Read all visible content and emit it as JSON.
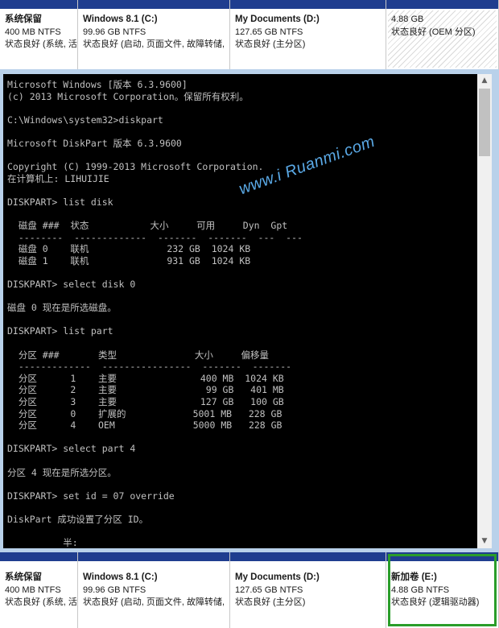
{
  "top_partitions": [
    {
      "name": "系统保留",
      "size": "400 MB NTFS",
      "status": "状态良好 (系统, 活"
    },
    {
      "name": "Windows 8.1  (C:)",
      "size": "99.96 GB NTFS",
      "status": "状态良好 (启动, 页面文件, 故障转储,"
    },
    {
      "name": "My Documents  (D:)",
      "size": "127.65 GB NTFS",
      "status": "状态良好 (主分区)"
    },
    {
      "name": "",
      "size": "4.88 GB",
      "status": "状态良好 (OEM 分区)"
    }
  ],
  "bottom_partitions": [
    {
      "name": "系统保留",
      "size": "400 MB NTFS",
      "status": "状态良好 (系统, 活"
    },
    {
      "name": "Windows 8.1  (C:)",
      "size": "99.96 GB NTFS",
      "status": "状态良好 (启动, 页面文件, 故障转储,"
    },
    {
      "name": "My Documents  (D:)",
      "size": "127.65 GB NTFS",
      "status": "状态良好 (主分区)"
    },
    {
      "name": "新加卷  (E:)",
      "size": "4.88 GB NTFS",
      "status": "状态良好 (逻辑驱动器)"
    }
  ],
  "console": {
    "lines": [
      "Microsoft Windows [版本 6.3.9600]",
      "(c) 2013 Microsoft Corporation。保留所有权利。",
      "",
      "C:\\Windows\\system32>diskpart",
      "",
      "Microsoft DiskPart 版本 6.3.9600",
      "",
      "Copyright (C) 1999-2013 Microsoft Corporation.",
      "在计算机上: LIHUIJIE",
      "",
      "DISKPART> list disk",
      "",
      "  磁盘 ###  状态           大小     可用     Dyn  Gpt",
      "  --------  -------------  -------  -------  ---  ---",
      "  磁盘 0    联机              232 GB  1024 KB",
      "  磁盘 1    联机              931 GB  1024 KB",
      "",
      "DISKPART> select disk 0",
      "",
      "磁盘 0 现在是所选磁盘。",
      "",
      "DISKPART> list part",
      "",
      "  分区 ###       类型              大小     偏移量",
      "  -------------  ----------------  -------  -------",
      "  分区      1    主要               400 MB  1024 KB",
      "  分区      2    主要                99 GB   401 MB",
      "  分区      3    主要               127 GB   100 GB",
      "  分区      0    扩展的            5001 MB   228 GB",
      "  分区      4    OEM              5000 MB   228 GB",
      "",
      "DISKPART> select part 4",
      "",
      "分区 4 现在是所选分区。",
      "",
      "DISKPART> set id = 07 override",
      "",
      "DiskPart 成功设置了分区 ID。",
      "",
      "          半:"
    ]
  },
  "watermark": "www.i Ruanmi.com",
  "scrollbar": {
    "up_icon": "▲",
    "down_icon": "▼"
  }
}
